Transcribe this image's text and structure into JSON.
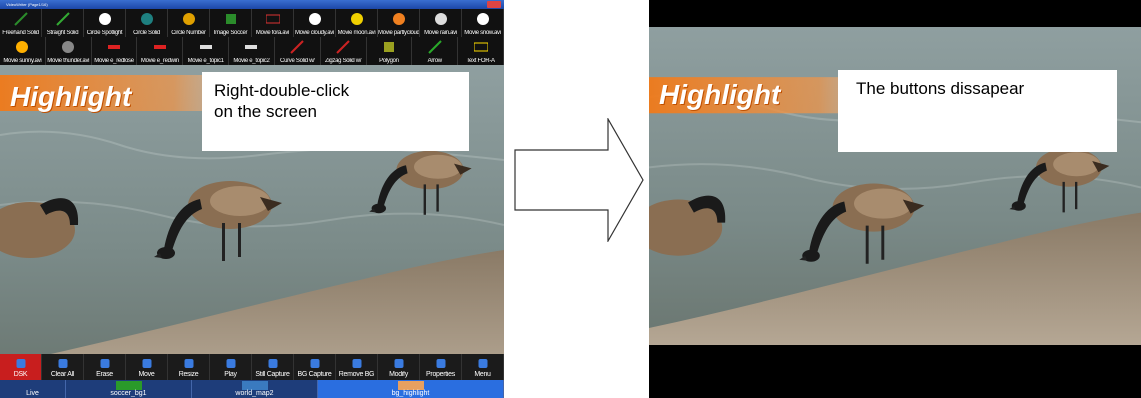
{
  "left_screen": {
    "window_title": "VideoWriter (Page1/16)",
    "toolbar_row1": [
      {
        "label": "Freehand Solid",
        "icon": "pen-icon",
        "color": "#2b8c2b"
      },
      {
        "label": "Straight Solid",
        "icon": "line-icon",
        "color": "#33aa33"
      },
      {
        "label": "Circle Spotlight",
        "icon": "spotlight-icon",
        "color": "#ffffff"
      },
      {
        "label": "Circle Solid",
        "icon": "circle-icon",
        "color": "#1e8080"
      },
      {
        "label": "Circle Number",
        "icon": "number-icon",
        "color": "#e0a000"
      },
      {
        "label": "Image Soccer",
        "icon": "soccer-icon",
        "color": "#2b8c2b"
      },
      {
        "label": "Movie fora.avi",
        "icon": "for-a-logo-icon",
        "color": "#d33"
      },
      {
        "label": "Movie cloudy.avi",
        "icon": "cloud-icon",
        "color": "#ffffff"
      },
      {
        "label": "Movie moon.avi",
        "icon": "moon-icon",
        "color": "#f0d000"
      },
      {
        "label": "Movie partlycloudy",
        "icon": "partly-cloudy-icon",
        "color": "#f08020"
      },
      {
        "label": "Movie rain.avi",
        "icon": "rain-icon",
        "color": "#dddddd"
      },
      {
        "label": "Movie snow.avi",
        "icon": "snowman-icon",
        "color": "#ffffff"
      }
    ],
    "toolbar_row2": [
      {
        "label": "Movie sunny.avi",
        "icon": "sun-icon",
        "color": "#ffb000"
      },
      {
        "label": "Movie thunder.avi",
        "icon": "thunder-icon",
        "color": "#888888"
      },
      {
        "label": "Movie e_redlose",
        "icon": "red-bar-icon",
        "color": "#d22"
      },
      {
        "label": "Movie e_redwin",
        "icon": "red-bar-icon",
        "color": "#d22"
      },
      {
        "label": "Movie e_topic1",
        "icon": "topic-bar-icon",
        "color": "#dddddd"
      },
      {
        "label": "Movie e_topic2",
        "icon": "topic-bar-icon",
        "color": "#dddddd"
      },
      {
        "label": "Curve Solid w/",
        "icon": "curve-icon",
        "color": "#cc2222"
      },
      {
        "label": "Zigzag Solid w/",
        "icon": "zigzag-icon",
        "color": "#cc2222"
      },
      {
        "label": "Polygon",
        "icon": "polygon-icon",
        "color": "#9aa020"
      },
      {
        "label": "Arrow",
        "icon": "arrow-icon",
        "color": "#2aaa2a"
      },
      {
        "label": "Text FOR-A",
        "icon": "text-icon",
        "color": "#ffdd00"
      }
    ],
    "bottom_buttons": [
      {
        "label": "DSK",
        "icon": "dsk-icon",
        "active": true
      },
      {
        "label": "Clear All",
        "icon": "trash-icon"
      },
      {
        "label": "Erase",
        "icon": "eraser-icon"
      },
      {
        "label": "Move",
        "icon": "hand-icon"
      },
      {
        "label": "Resize",
        "icon": "resize-icon"
      },
      {
        "label": "Play",
        "icon": "play-icon"
      },
      {
        "label": "Still Capture",
        "icon": "camera-icon"
      },
      {
        "label": "BG Capture",
        "icon": "bg-capture-icon"
      },
      {
        "label": "Remove BG",
        "icon": "remove-bg-icon"
      },
      {
        "label": "Modify",
        "icon": "modify-icon"
      },
      {
        "label": "Properties",
        "icon": "gear-icon"
      },
      {
        "label": "Menu",
        "icon": "menu-icon"
      }
    ],
    "page_tabs": [
      {
        "label": "Live",
        "selected": false
      },
      {
        "label": "soccer_bg1",
        "selected": false
      },
      {
        "label": "world_map2",
        "selected": false
      },
      {
        "label": "bg_highlight",
        "selected": true
      }
    ],
    "overlay_title": "Highlight"
  },
  "callout_left": {
    "line1": "Right-double-click",
    "line2": "on the screen"
  },
  "callout_right": {
    "text": "The buttons dissapear"
  },
  "right_screen": {
    "overlay_title": "Highlight"
  },
  "colors": {
    "accent_orange": "#f07a1a",
    "active_button": "#c81e1e",
    "page_tab_selected": "#2a6ee0"
  }
}
